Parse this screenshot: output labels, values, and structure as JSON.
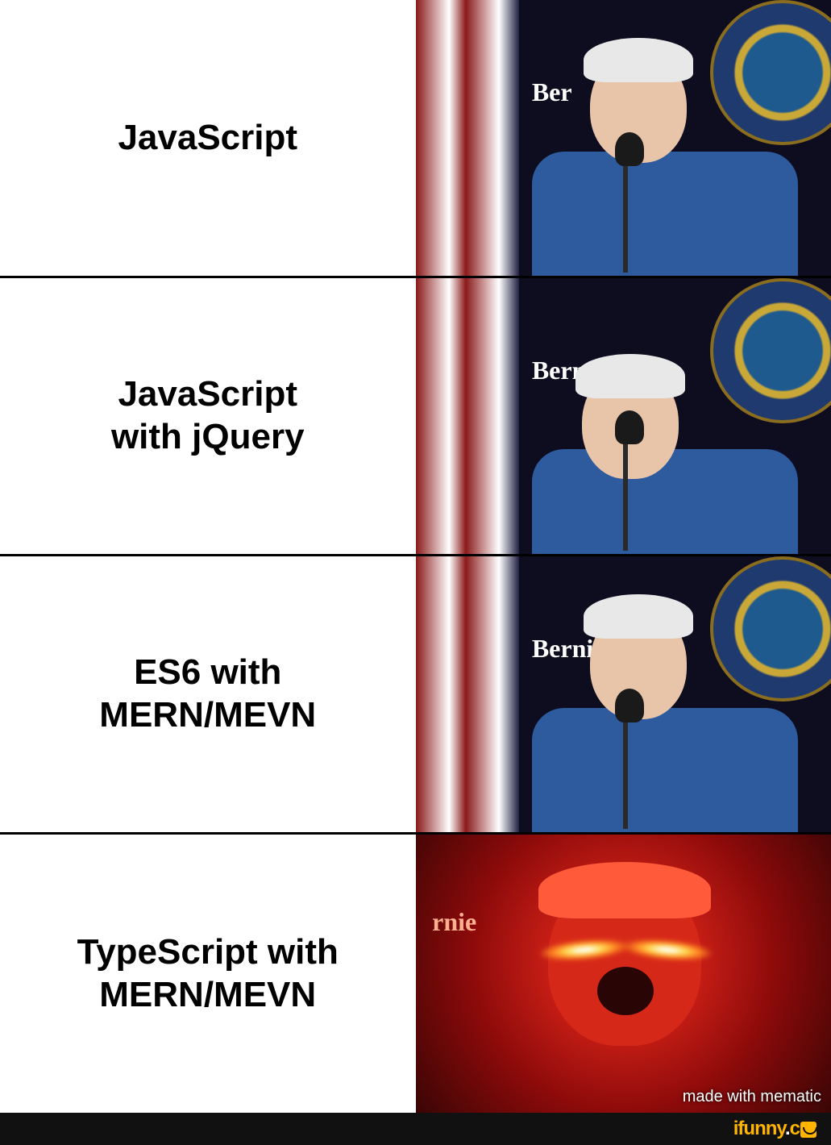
{
  "panels": [
    {
      "caption": "JavaScript",
      "sign": "Ber"
    },
    {
      "caption": "JavaScript\nwith jQuery",
      "sign": "Bernie"
    },
    {
      "caption": "ES6 with\nMERN/MEVN",
      "sign": "Berni"
    },
    {
      "caption": "TypeScript with\nMERN/MEVN",
      "sign": "rnie"
    }
  ],
  "watermarks": {
    "mematic": "made with mematic",
    "ifunny_prefix": "ifunny",
    "ifunny_dot": ".",
    "ifunny_suffix": "c"
  }
}
